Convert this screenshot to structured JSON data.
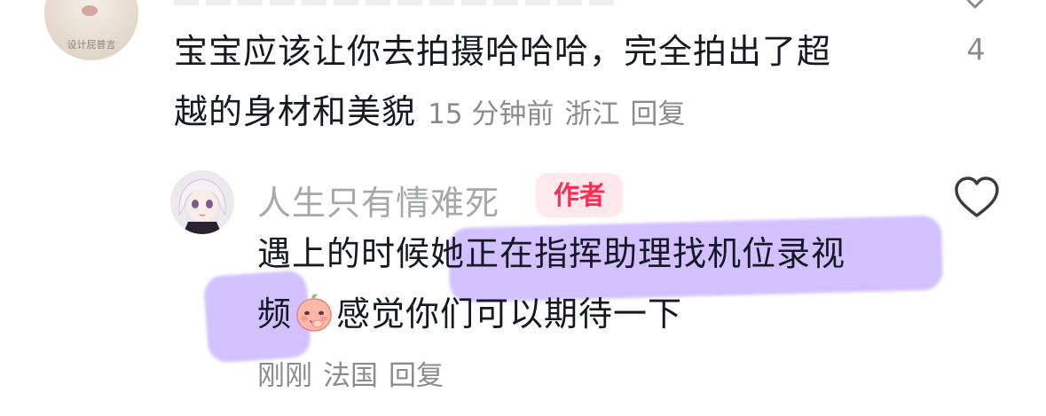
{
  "comment_1": {
    "avatar_caption": "设计屁普言",
    "text_line_1": "宝宝应该让你去拍摄哈哈哈，完全拍出了超",
    "text_line_2": "越的身材和美貌",
    "time": "15 分钟前",
    "location": "浙江",
    "reply_label": "回复",
    "like_count": "4"
  },
  "comment_2": {
    "username": "人生只有情难死",
    "author_badge": "作者",
    "text_line_1": "遇上的时候她正在指挥助理找机位录视",
    "text_line_2_before_emoji": "频",
    "emoji": "peach-blush-emoji",
    "text_line_2_after_emoji": "感觉你们可以期待一下",
    "time": "刚刚",
    "location": "法国",
    "reply_label": "回复"
  },
  "colors": {
    "primary_text": "#161823",
    "secondary_text": "#8a8b91",
    "username": "#a6a7ad",
    "author_badge_text": "#fe2c55",
    "author_badge_bg": "#fde9ec",
    "highlight": "#b79bff"
  },
  "icons": {
    "like": "heart-outline-icon",
    "collapse": "chevron-down-icon"
  }
}
